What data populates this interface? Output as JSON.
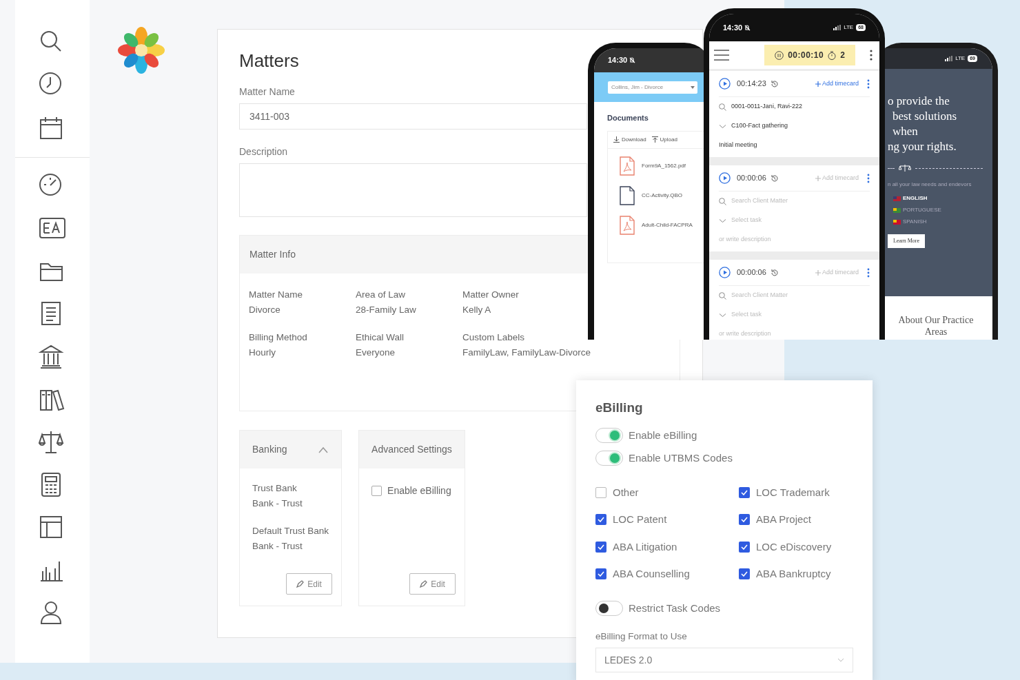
{
  "matters": {
    "title": "Matters",
    "matter_name_label": "Matter Name",
    "matter_name_value": "3411-003",
    "description_label": "Description",
    "matter_info": {
      "title": "Matter Info",
      "fields": [
        {
          "label": "Matter Name",
          "value": "Divorce"
        },
        {
          "label": "Area of Law",
          "value": "28-Family Law"
        },
        {
          "label": "Matter Owner",
          "value": "Kelly A"
        },
        {
          "label": "Billing Method",
          "value": "Hourly"
        },
        {
          "label": "Ethical Wall",
          "value": "Everyone"
        },
        {
          "label": "Custom Labels",
          "value": "FamilyLaw, FamilyLaw-Divorce"
        }
      ]
    },
    "banking": {
      "title": "Banking",
      "expanded": true,
      "fields": [
        {
          "label": "Trust Bank",
          "value": "Bank - Trust"
        },
        {
          "label": "Default Trust Bank",
          "value": "Bank - Trust"
        }
      ],
      "edit_button": "Edit"
    },
    "advanced_settings": {
      "title": "Advanced Settings",
      "checkbox": {
        "label": "Enable eBilling",
        "checked": false
      },
      "edit_button": "Edit"
    }
  },
  "phone_documents": {
    "status_time": "14:30",
    "matter_select": "Collins, Jim - Divorce",
    "heading": "Documents",
    "actions": [
      "Download",
      "Upload"
    ],
    "files": [
      {
        "name": "Form9A_1562.pdf",
        "kind": "pdf"
      },
      {
        "name": "CC-Activity.QBO",
        "kind": "file"
      },
      {
        "name": "Adult-Child-FACPRA",
        "kind": "pdf"
      }
    ]
  },
  "phone_timer": {
    "status_time": "14:30",
    "network": "LTE",
    "battery": "68",
    "timer": "00:00:10",
    "timer_count": "2",
    "cards": [
      {
        "time": "00:14:23",
        "add_label": "Add timecard",
        "disabled": false,
        "client_matter": "0001-0011-Jani, Ravi-222",
        "task": "C100-Fact gathering",
        "description": "Initial meeting"
      },
      {
        "time": "00:00:06",
        "add_label": "Add timecard",
        "disabled": true,
        "client_matter_placeholder": "Search Client Matter",
        "task_placeholder": "Select task",
        "description_placeholder": "or write description"
      },
      {
        "time": "00:00:06",
        "add_label": "Add timecard",
        "disabled": true,
        "client_matter_placeholder": "Search Client Matter",
        "task_placeholder": "Select task",
        "description_placeholder": "or write description"
      }
    ]
  },
  "phone_website": {
    "network": "LTE",
    "battery": "69",
    "headline": [
      "o provide the",
      "best solutions",
      "when",
      "ng your rights."
    ],
    "tagline": "n all your law needs and endevors",
    "languages": [
      {
        "label": "ENGLISH",
        "selected": true
      },
      {
        "label": "PORTUGUESE",
        "selected": false
      },
      {
        "label": "SPANISH",
        "selected": false
      }
    ],
    "button": "Learn More",
    "section_title": "About Our Practice Areas"
  },
  "ebilling": {
    "title": "eBilling",
    "toggles": [
      {
        "label": "Enable eBilling",
        "on": true
      },
      {
        "label": "Enable UTBMS Codes",
        "on": true
      }
    ],
    "codes": [
      {
        "label": "Other",
        "checked": false
      },
      {
        "label": "LOC Trademark",
        "checked": true
      },
      {
        "label": "LOC Patent",
        "checked": true
      },
      {
        "label": "ABA Project",
        "checked": true
      },
      {
        "label": "ABA Litigation",
        "checked": true
      },
      {
        "label": "LOC eDiscovery",
        "checked": true
      },
      {
        "label": "ABA Counselling",
        "checked": true
      },
      {
        "label": "ABA Bankruptcy",
        "checked": true
      }
    ],
    "restrict_toggle": {
      "label": "Restrict Task Codes",
      "on": false
    },
    "format_label": "eBilling Format to Use",
    "format_value": "LEDES 2.0"
  }
}
